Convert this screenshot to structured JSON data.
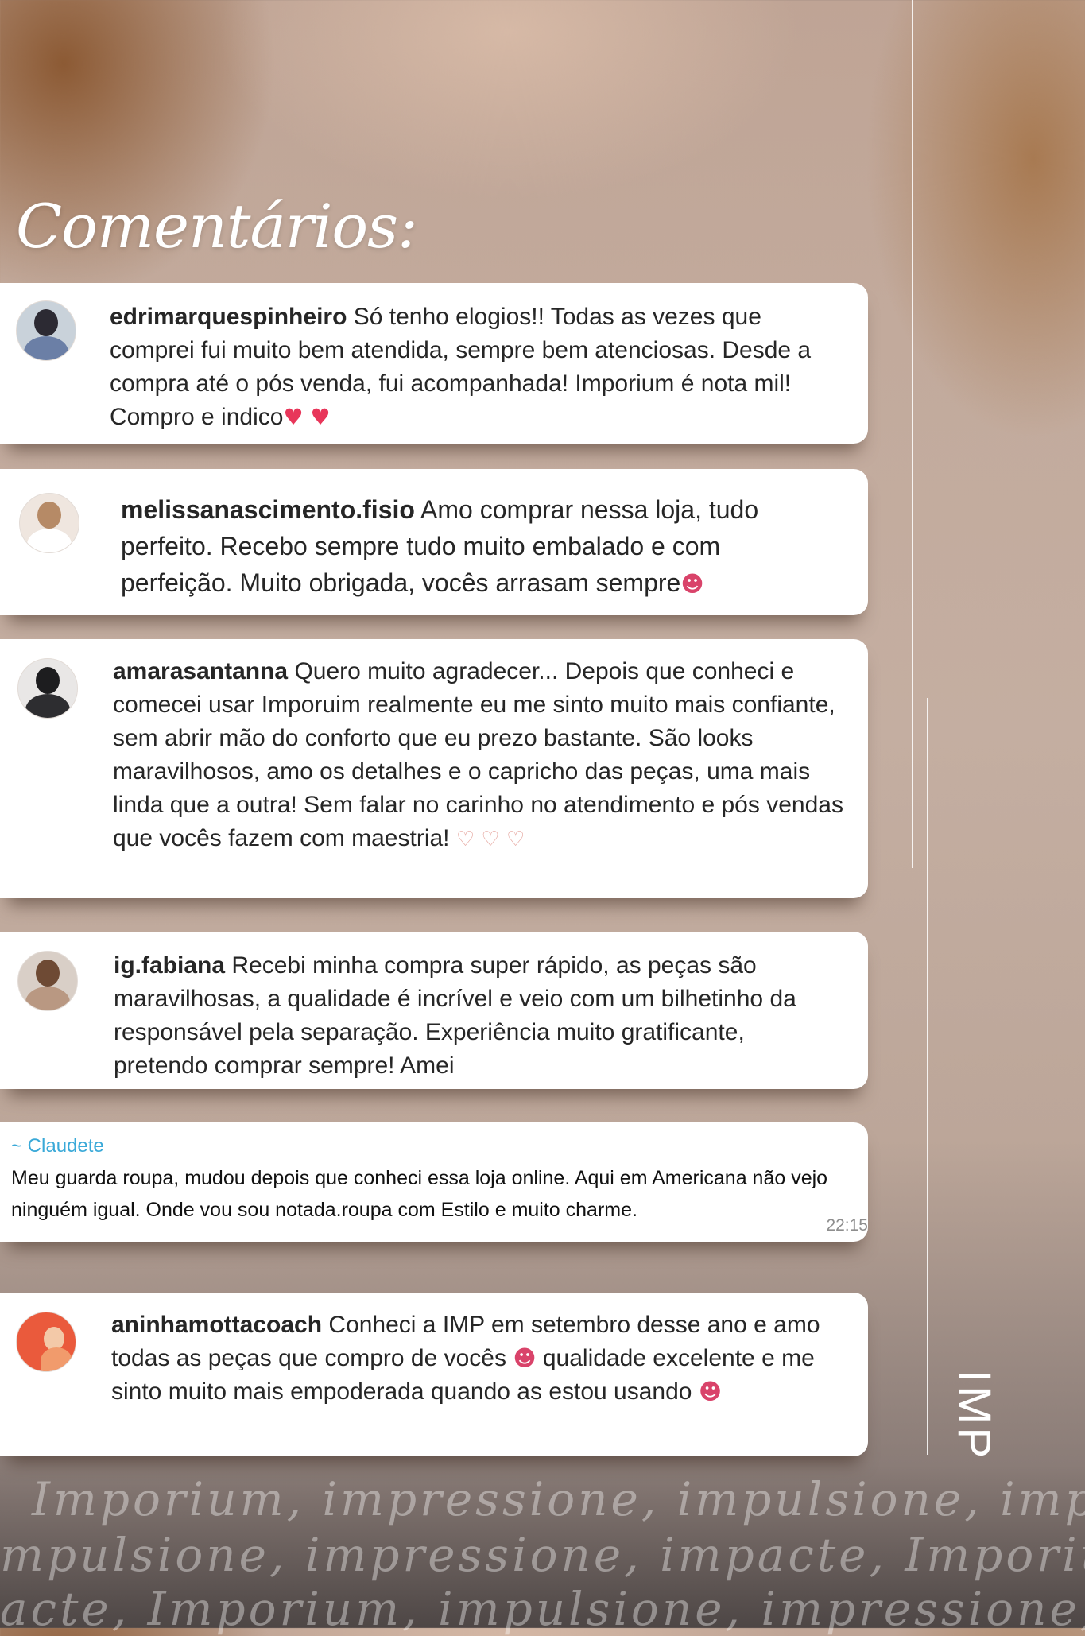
{
  "title": "Comentários:",
  "logo_text": "IMP",
  "slogan_lines": [
    "Imporium, impressione, impulsione, impacte,",
    "mpulsione, impressione, impacte, Imporium,",
    "acte, Imporium, impulsione, impressione, I"
  ],
  "comments": [
    {
      "username": "edrimarquespinheiro",
      "text": " Só tenho elogios!! Todas as vezes que comprei fui muito bem atendida, sempre bem atenciosas. Desde a compra até o pós venda, fui acompanhada! Imporium é nota mil! Compro e indico",
      "emoji": "♥ ♥"
    },
    {
      "username": "melissanascimento.fisio",
      "text": " Amo comprar nessa loja, tudo perfeito. Recebo sempre tudo muito embalado e com perfeição. Muito obrigada, vocês arrasam sempre",
      "emoji": "☻"
    },
    {
      "username": "amarasantanna",
      "text": " Quero muito agradecer... Depois que conheci e comecei usar Imporuim realmente eu me sinto muito mais confiante, sem abrir mão do conforto que eu prezo bastante. São looks maravilhosos, amo os detalhes e o capricho das peças, uma mais linda que a outra! Sem falar no carinho no atendimento e pós vendas que vocês fazem com maestria!",
      "emoji": "♡ ♡ ♡"
    },
    {
      "username": "ig.fabiana",
      "text": " Recebi minha compra super rápido, as peças são maravilhosas, a qualidade é incrível e veio com um bilhetinho da responsável pela separação. Experiência muito gratificante, pretendo comprar sempre! Amei",
      "emoji": ""
    }
  ],
  "whatsapp": {
    "name": "~ Claudete",
    "text": "Meu guarda roupa, mudou depois que conheci essa loja online. Aqui em Americana não vejo ninguém igual. Onde vou sou notada.roupa com Estilo e muito charme.",
    "time": "22:15"
  },
  "last_comment": {
    "username": "aninhamottacoach",
    "text_1": " Conheci a IMP em setembro desse ano e amo todas as peças que compro de vocês ",
    "emoji_1": "☻",
    "text_2": " qualidade excelente e me sinto muito mais empoderada quando as estou usando ",
    "emoji_2": "☻"
  },
  "colors": {
    "card_bg": "#ffffff",
    "text": "#262626",
    "whatsapp_name": "#3aa9d8",
    "heart": "#e8365a"
  }
}
